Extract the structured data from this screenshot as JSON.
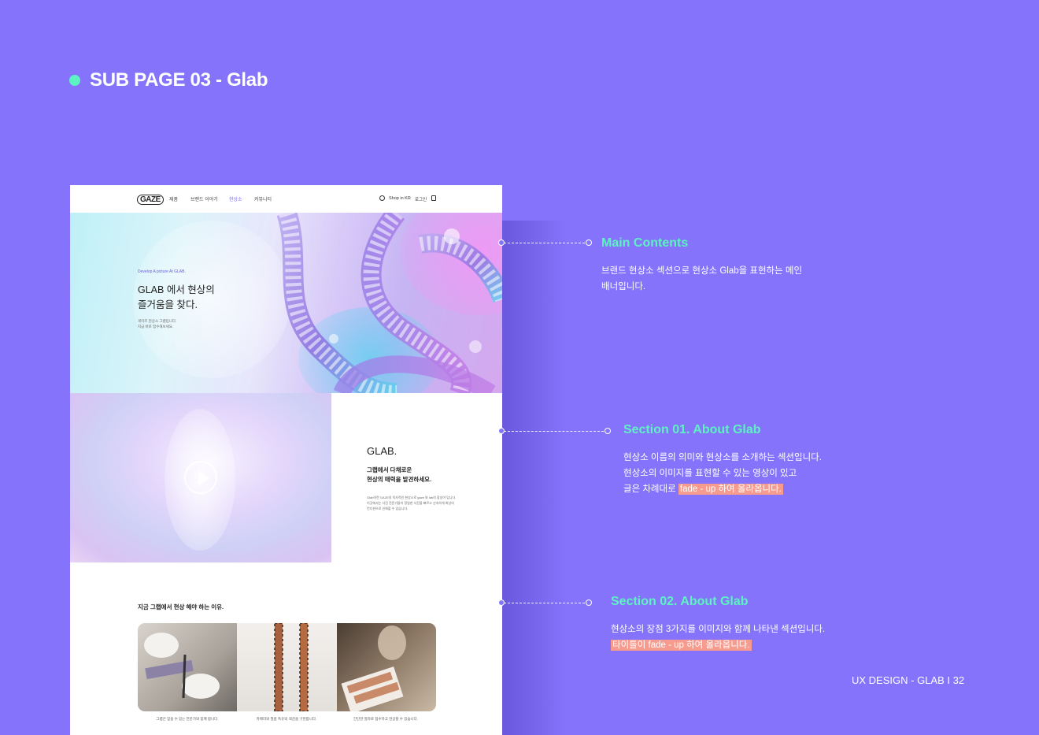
{
  "page": {
    "title": "SUB PAGE 03 - Glab",
    "footer": "UX DESIGN - GLAB I 32",
    "accent_color": "#5df2c2",
    "background_color": "#8574fb",
    "highlight_color": "#f79b8f"
  },
  "mockup": {
    "nav": {
      "logo": "GAZE",
      "items": [
        "제품",
        "브랜드 이야기",
        "현상소",
        "커뮤니티"
      ],
      "active_item": "현상소",
      "shop": "Shop in KR",
      "login": "로그인"
    },
    "hero": {
      "eyebrow": "Develop A picture At GLAB.",
      "title_line1": "GLAB 에서 현상의",
      "title_line2": "즐거움을 찾다.",
      "sub_line1": "게이즈 현상소 그랩입니다.",
      "sub_line2": "지금 바로 접수해보세요."
    },
    "section1": {
      "title": "GLAB.",
      "headline_line1": "그랩에서 다채로운",
      "headline_line2": "현상의 매력을 발견하세요.",
      "body_line1": "Glab이란 GAZE의 독자적인 현상소로 gaze 와 lab의 합성어 입니다.",
      "body_line2": "이곳에서는 사진 전문가들이 정밀한 사진을 빠르고 신속하게 최상의",
      "body_line3": "컨디션으로 인화할 수 있습니다."
    },
    "section2": {
      "heading": "지금 그랩에서 현상 해야 하는 이유.",
      "captions": [
        "그랩은 믿을 수 있는 전문가와 함께 합니다.",
        "카메라와 필름 특유의 색감을 구현합니다.",
        "간단한 절차로 접수하고 현상할 수 있습니다."
      ]
    }
  },
  "annotations": {
    "main": {
      "title": "Main Contents",
      "line1": "브랜드 현상소 섹션으로 현상소 Glab을 표현하는 메인",
      "line2": "배너입니다."
    },
    "section1": {
      "title": "Section 01. About Glab",
      "line1": "현상소 이름의 의미와 현상소를 소개하는 섹션입니다.",
      "line2": "현상소의 이미지를 표현할 수  있는 영상이 있고",
      "line3_pre": "글은 차례대로 ",
      "line3_hl": "fade - up 하여 올라옵니다."
    },
    "section2": {
      "title": "Section 02. About Glab",
      "line1": "현상소의 장점 3가지를 이미지와 함께 나타낸 섹션입니다.",
      "line2_hl": "타이틀이 fade - up 하여 올라옵니다."
    }
  }
}
